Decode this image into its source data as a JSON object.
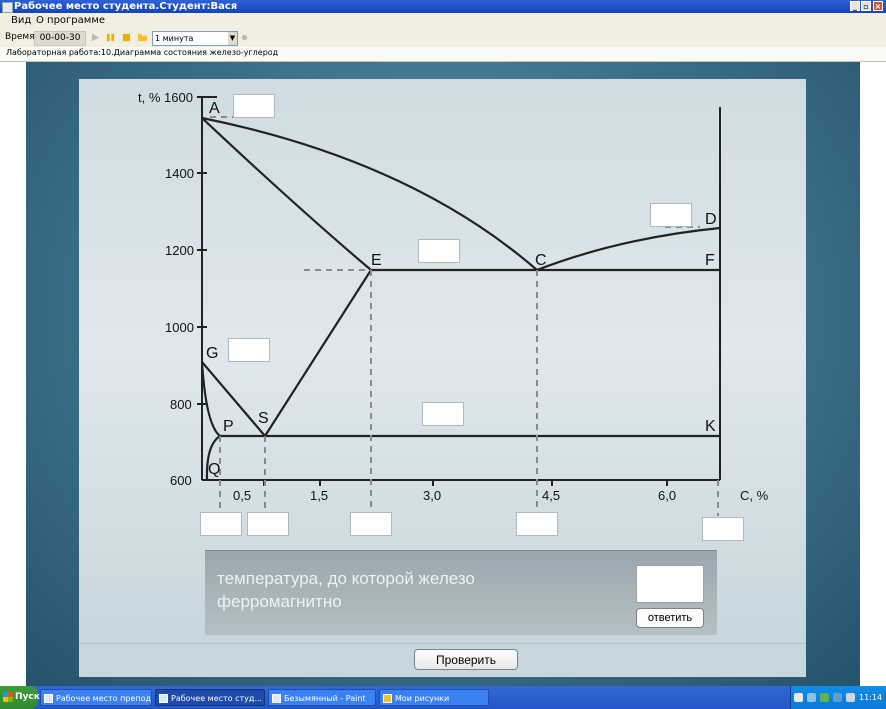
{
  "window": {
    "title": "Рабочее место студента.Студент:Вася",
    "min": "_",
    "max": "▫",
    "close": "×"
  },
  "menu": {
    "items": [
      "Вид",
      "О программе"
    ]
  },
  "toolbar": {
    "time_label": "Время",
    "time_value": "00-00-30",
    "interval": "1 минута"
  },
  "tab": {
    "title": "Лабораторная работа:10.Диаграмма состояния железо-углерод"
  },
  "diagram": {
    "y_axis_label": "t, % 1600",
    "x_axis_label": "С, %",
    "y_ticks": [
      "1400",
      "1200",
      "1000",
      "800",
      "600"
    ],
    "x_ticks": [
      "0,5",
      "1,5",
      "3,0",
      "4,5",
      "6,0"
    ],
    "points": [
      "A",
      "D",
      "E",
      "C",
      "F",
      "G",
      "P",
      "S",
      "K",
      "Q"
    ]
  },
  "question": {
    "text": "температура, до которой железо ферромагнитно",
    "answer_button": "ответить"
  },
  "check_button": "Проверить",
  "taskbar": {
    "start": "Пуск",
    "tasks": [
      "Рабочее место препода...",
      "Рабочее место студ...",
      "Безымянный - Paint",
      "Мои рисунки"
    ],
    "clock": "11:14"
  },
  "colors": {
    "title_bar": "#1544b8",
    "panel": "#d5e1e6",
    "line": "#222222",
    "dash": "#8a8a8a",
    "taskbar": "#2456c7"
  },
  "icons": [
    "play-icon",
    "pause-icon",
    "stop-icon",
    "folder-icon",
    "settings-icon"
  ]
}
